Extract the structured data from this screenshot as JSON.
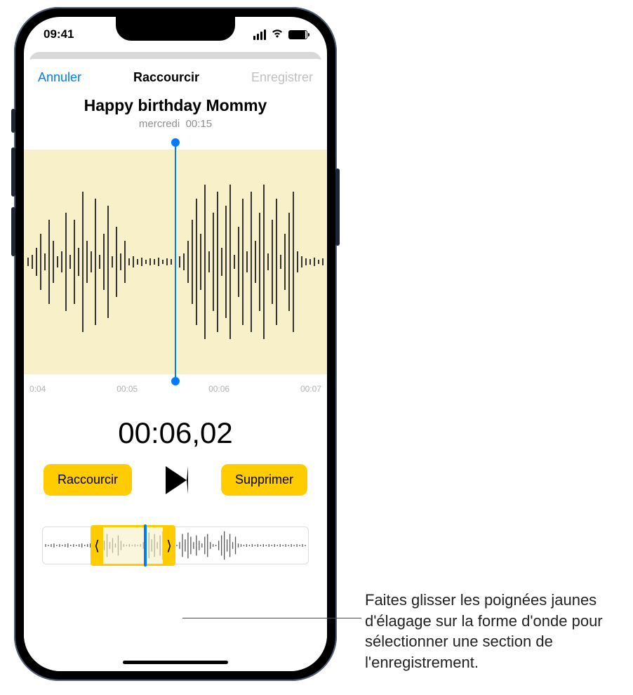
{
  "status": {
    "time": "09:41"
  },
  "nav": {
    "cancel": "Annuler",
    "title": "Raccourcir",
    "save": "Enregistrer"
  },
  "recording": {
    "title": "Happy birthday Mommy",
    "day": "mercredi",
    "duration": "00:15"
  },
  "ticks": {
    "t0": "0:04",
    "t1": "00:05",
    "t2": "00:06",
    "t3": "00:07"
  },
  "timecode": "00:06,02",
  "buttons": {
    "trim": "Raccourcir",
    "delete": "Supprimer"
  },
  "trim_handles": {
    "left": "⟨",
    "right": "⟩"
  },
  "callout": "Faites glisser les poignées jaunes d'élagage sur la forme d'onde pour sélectionner une section de l'enregistrement."
}
